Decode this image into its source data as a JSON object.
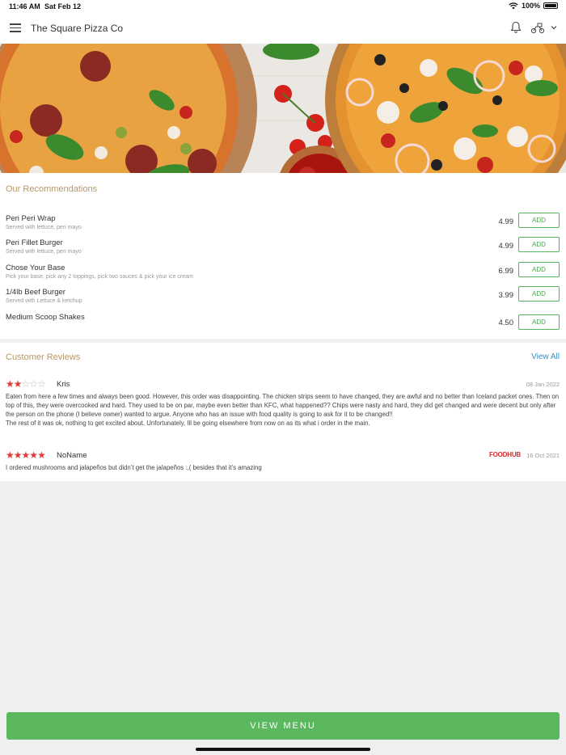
{
  "status_bar": {
    "time": "11:46 AM",
    "date": "Sat Feb 12",
    "battery": "100%",
    "battery_level": 1.0
  },
  "header": {
    "title": "The Square Pizza Co",
    "icons": [
      "menu-icon",
      "bell-icon",
      "delivery-icon",
      "chevron-down-icon"
    ]
  },
  "recommendations": {
    "title": "Our Recommendations",
    "add_label": "ADD",
    "items": [
      {
        "name": "Peri Peri Wrap",
        "desc": "Served with lettuce, peri mayo",
        "price": "4.99"
      },
      {
        "name": "Peri Fillet Burger",
        "desc": "Served with lettuce, peri mayo",
        "price": "4.99"
      },
      {
        "name": "Chose Your Base",
        "desc": "Pick your base, pick any 2 toppings, pick two sauces & pick your ice cream",
        "price": "6.99"
      },
      {
        "name": "1/4lb Beef Burger",
        "desc": "Served with Lettuce & ketchup",
        "price": "3.99"
      },
      {
        "name": "Medium Scoop Shakes",
        "desc": "",
        "price": "4.50"
      }
    ]
  },
  "reviews": {
    "title": "Customer Reviews",
    "view_all": "View All",
    "items": [
      {
        "name": "Kris",
        "rating": 2,
        "max_rating": 5,
        "date": "08 Jan 2022",
        "source": "",
        "text": "Eaten from here a few times and always been good. However, this order was disappointing. The chicken strips seem to have changed, they are awful and no better than Iceland packet ones. Then on top of this, they were overcooked and hard. They used to be on par, maybe even better than KFC, what happened?? Chips were nasty and hard, they did get changed and were decent but only after the person on the phone (I believe owner) wanted to argue. Anyone who has an issue with food quality is going to ask for it to be changed!!\nThe rest of it was ok, nothing to get excited about. Unfortunately, Ill be going elsewhere from now on as its what i order in the main."
      },
      {
        "name": "NoName",
        "rating": 5,
        "max_rating": 5,
        "date": "16 Oct 2021",
        "source": "FOODHUB",
        "text": "I ordered mushrooms and jalapeños but didn’t get the jalapeños :,( besides that it’s amazing"
      }
    ]
  },
  "footer": {
    "view_menu": "VIEW MENU"
  },
  "colors": {
    "accent_green": "#5cb85f",
    "section_title": "#b89866",
    "star": "#e03a3a",
    "link": "#3a8fbf"
  }
}
